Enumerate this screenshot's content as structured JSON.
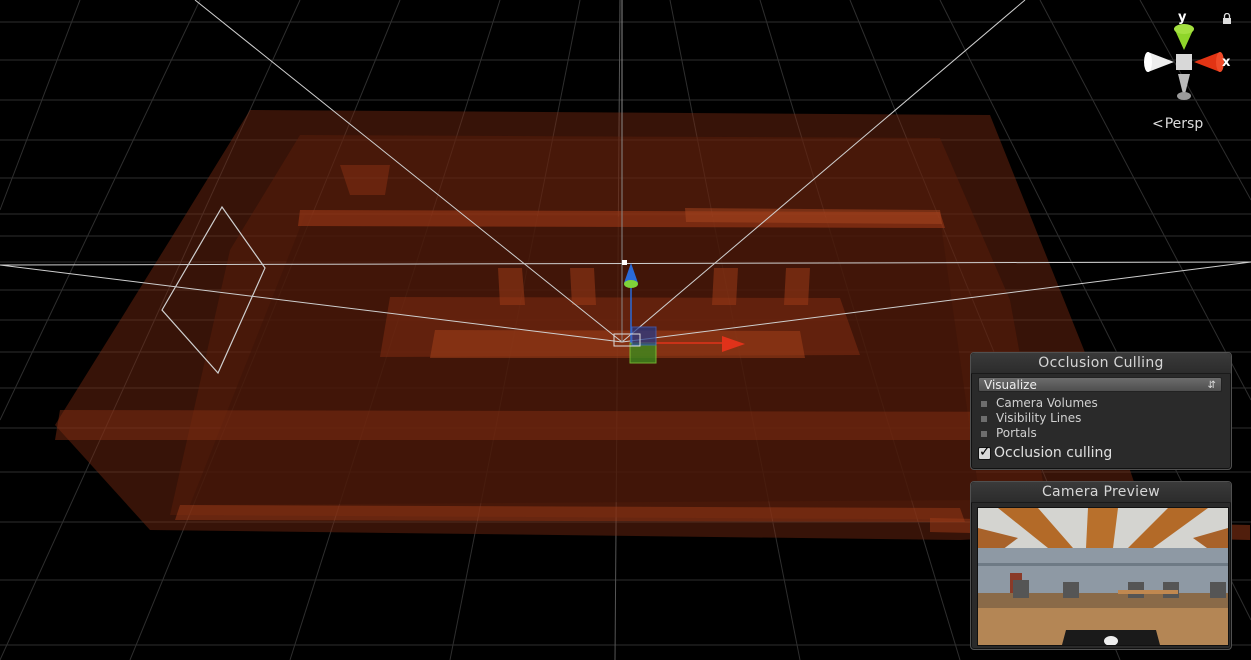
{
  "scene_view": {
    "projection_label": "Persp",
    "gizmo": {
      "y_axis_label": "y",
      "x_axis_label": "x",
      "lock_icon": "lock-icon",
      "colors": {
        "y": "#8fd52a",
        "x": "#e23414",
        "z": "#eeeeee",
        "center": "#d8d8d8"
      }
    },
    "move_handle_colors": {
      "x": "#e0321a",
      "y": "#7fd43a",
      "z": "#2a6ad8"
    }
  },
  "occlusion_panel": {
    "title": "Occlusion Culling",
    "mode_selected": "Visualize",
    "legend": [
      {
        "label": "Camera Volumes"
      },
      {
        "label": "Visibility Lines"
      },
      {
        "label": "Portals"
      }
    ],
    "occlusion_culling_checkbox": {
      "label": "Occlusion culling",
      "checked": true
    }
  },
  "camera_preview_panel": {
    "title": "Camera Preview"
  },
  "colors": {
    "background": "#000000",
    "grid": "#2b2b2b",
    "geometry": "#b8401a",
    "frustum": "#d8d8d8",
    "panel_bg": "#2a2a2a"
  }
}
